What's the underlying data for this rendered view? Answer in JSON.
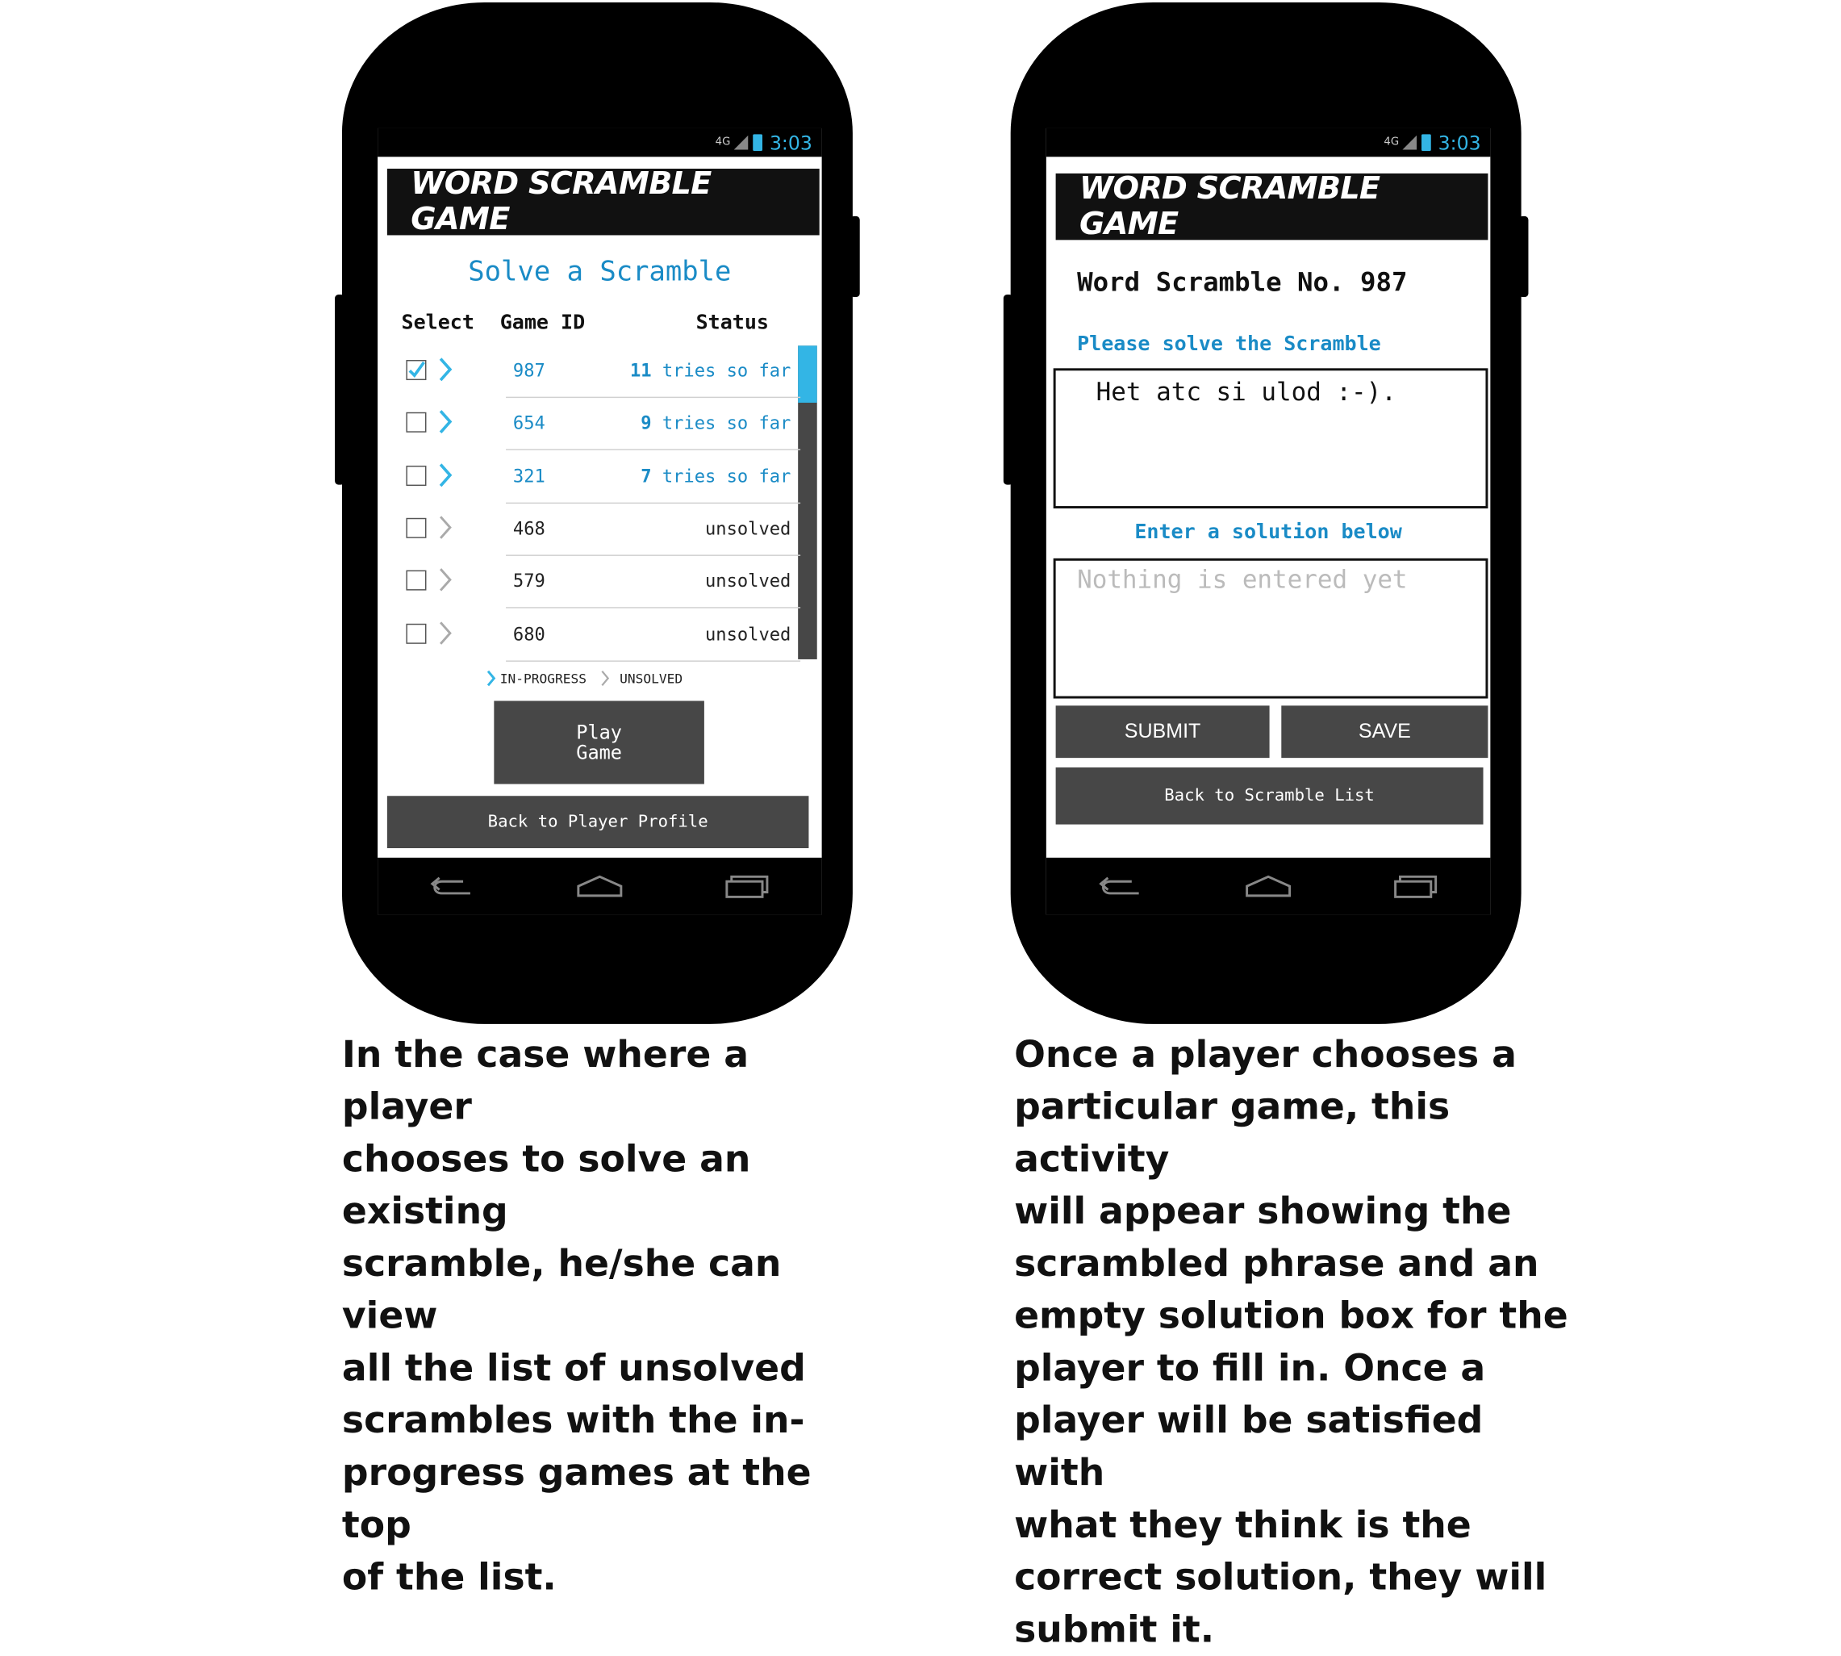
{
  "left_phone": {
    "status_bar": {
      "network": "4G",
      "time": "3:03"
    },
    "app_title": "WORD SCRAMBLE GAME",
    "screen_title": "Solve a Scramble",
    "columns": {
      "select": "Select",
      "game_id": "Game ID",
      "status": "Status"
    },
    "rows": [
      {
        "id": "987",
        "count": "11",
        "status_text": "tries so far",
        "checked": true,
        "in_progress": true
      },
      {
        "id": "654",
        "count": "9",
        "status_text": "tries so far",
        "checked": false,
        "in_progress": true
      },
      {
        "id": "321",
        "count": "7",
        "status_text": "tries so far",
        "checked": false,
        "in_progress": true
      },
      {
        "id": "468",
        "count": "",
        "status_text": "unsolved",
        "checked": false,
        "in_progress": false
      },
      {
        "id": "579",
        "count": "",
        "status_text": "unsolved",
        "checked": false,
        "in_progress": false
      },
      {
        "id": "680",
        "count": "",
        "status_text": "unsolved",
        "checked": false,
        "in_progress": false
      }
    ],
    "legend": {
      "in_progress": "IN-PROGRESS",
      "unsolved": "UNSOLVED"
    },
    "play_button": {
      "line1": "Play",
      "line2": "Game"
    },
    "back_button": "Back to Player Profile"
  },
  "right_phone": {
    "status_bar": {
      "network": "4G",
      "time": "3:03"
    },
    "app_title": "WORD SCRAMBLE GAME",
    "scramble_title": "Word Scramble No. 987",
    "prompt": "Please solve the Scramble",
    "scrambled_phrase": "Het atc si ulod :-).",
    "solution_label": "Enter a solution below",
    "solution_placeholder": "Nothing is entered yet",
    "submit_button": "SUBMIT",
    "save_button": "SAVE",
    "back_button": "Back to Scramble List"
  },
  "captions": {
    "left": "In the case where a player\nchooses to solve an existing\nscramble, he/she can view\nall the list of unsolved\nscrambles with the in-\nprogress games at the top\nof the list.",
    "right": "Once a player chooses a\nparticular game, this activity\nwill appear showing the\nscrambled phrase and an\nempty solution box for the\nplayer to fill in. Once a\nplayer will be satisfied with\nwhat they think is the\ncorrect solution, they will\nsubmit it."
  },
  "colors": {
    "accent": "#33b5e5",
    "title_blue": "#1a8bc6",
    "button_gray": "#474747",
    "header_black": "#111111"
  },
  "icons": [
    "back-nav-icon",
    "home-nav-icon",
    "recents-nav-icon",
    "chevron-right-icon",
    "checkbox-icon",
    "battery-icon",
    "signal-icon"
  ]
}
